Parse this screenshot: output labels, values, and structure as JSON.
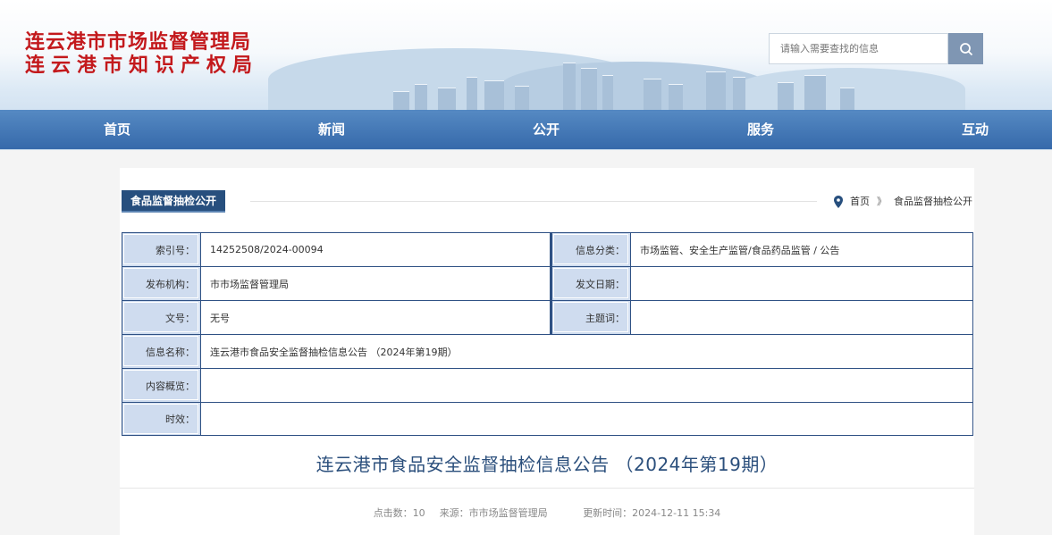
{
  "site": {
    "name_line1": "连云港市市场监督管理局",
    "name_line2": "连云港市知识产权局"
  },
  "search": {
    "placeholder": "请输入需要查找的信息"
  },
  "nav": [
    "首页",
    "新闻",
    "公开",
    "服务",
    "互动"
  ],
  "section": {
    "title": "食品监督抽检公开"
  },
  "breadcrumb": {
    "home": "首页",
    "separator": "》",
    "current": "食品监督抽检公开"
  },
  "meta": {
    "index_label": "索引号：",
    "index_value": "14252508/2024-00094",
    "category_label": "信息分类：",
    "category_value": "市场监管、安全生产监管/食品药品监管 / 公告",
    "publisher_label": "发布机构：",
    "publisher_value": "市市场监督管理局",
    "date_label": "发文日期：",
    "date_value": "",
    "doc_no_label": "文号：",
    "doc_no_value": "无号",
    "subject_label": "主题词：",
    "subject_value": "",
    "name_label": "信息名称：",
    "name_value": "连云港市食品安全监督抽检信息公告 （2024年第19期）",
    "summary_label": "内容概览：",
    "summary_value": "",
    "validity_label": "时效：",
    "validity_value": ""
  },
  "article": {
    "title": "连云港市食品安全监督抽检信息公告 （2024年第19期）",
    "clicks": "点击数：10",
    "source": "来源：市市场监督管理局",
    "updated": "更新时间：2024-12-11 15:34"
  },
  "colors": {
    "brand_red": "#c3191c",
    "nav_blue": "#2a60a5",
    "tab_navy": "#274f7e",
    "label_bg": "#cfdcef"
  }
}
